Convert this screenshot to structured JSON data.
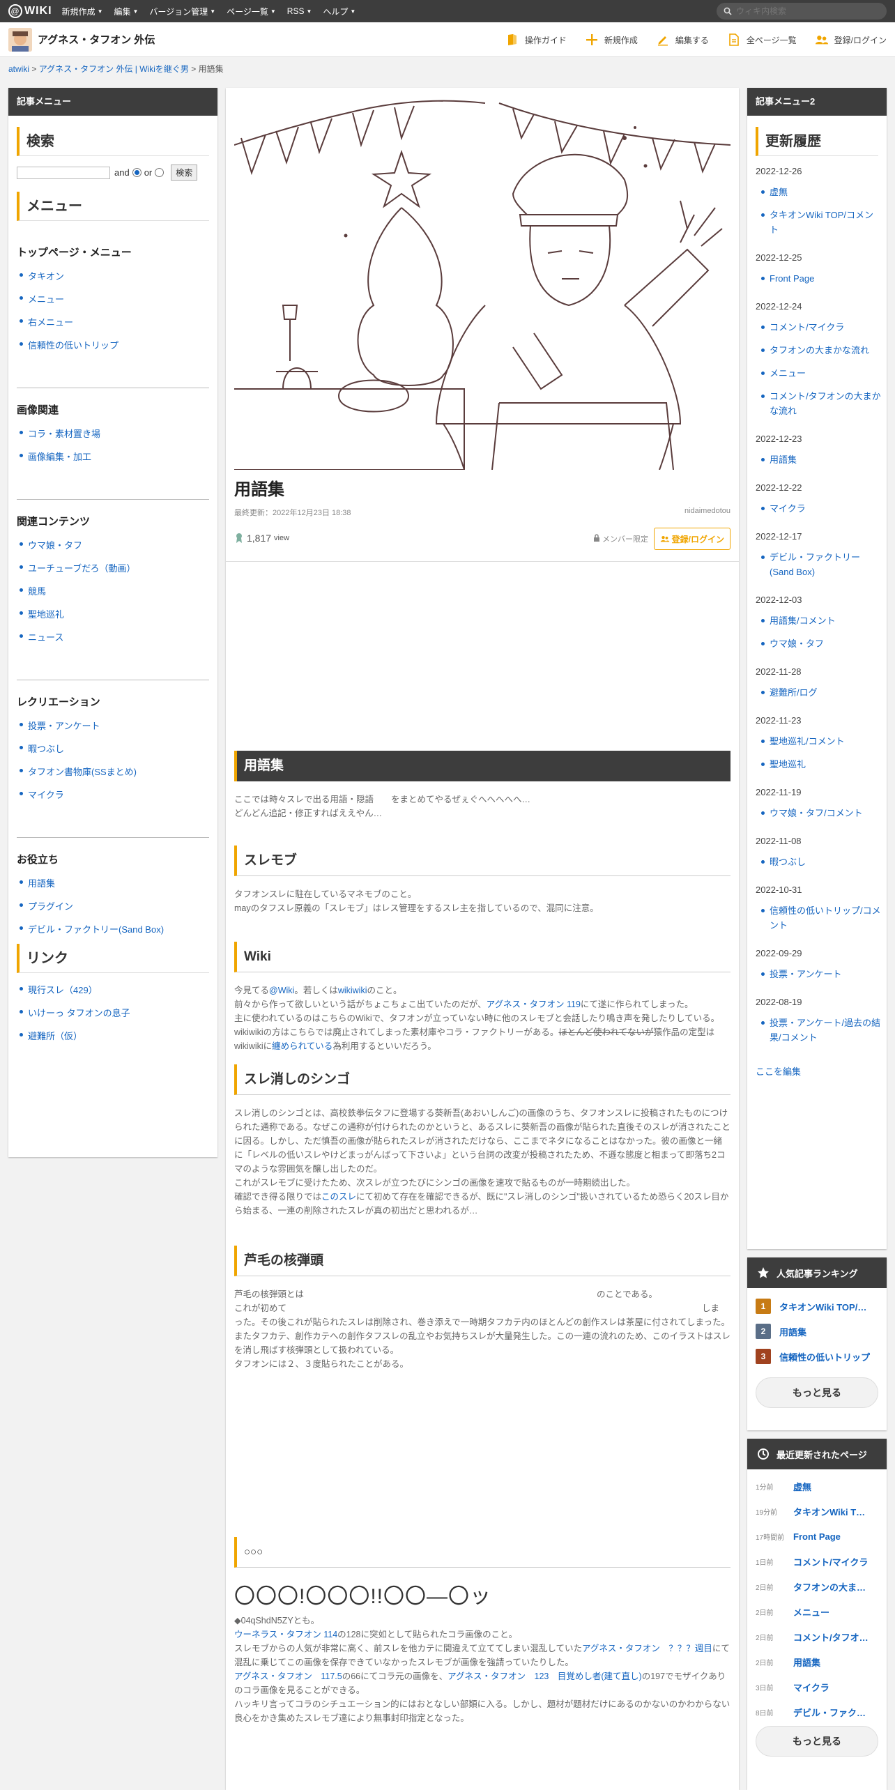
{
  "topbar": {
    "logo": "WIKI",
    "menus": [
      "新規作成",
      "編集",
      "バージョン管理",
      "ページ一覧",
      "RSS",
      "ヘルプ"
    ],
    "search_placeholder": "ウィキ内検索"
  },
  "header": {
    "site_title": "アグネス・タフオン 外伝",
    "actions": [
      "操作ガイド",
      "新規作成",
      "編集する",
      "全ページ一覧",
      "登録/ログイン"
    ]
  },
  "breadcrumb": [
    "atwiki",
    "アグネス・タフオン 外伝 | Wikiを継ぐ男",
    "用語集"
  ],
  "left_menu": {
    "panel_title": "記事メニュー",
    "search_title": "検索",
    "search_and": "and",
    "search_or": "or",
    "search_button": "検索",
    "menu_title": "メニュー",
    "groups": [
      {
        "heading": "トップページ・メニュー",
        "items": [
          "タキオン",
          "メニュー",
          "右メニュー",
          "信頼性の低いトリップ"
        ]
      },
      {
        "heading": "画像関連",
        "items": [
          "コラ・素材置き場",
          "画像編集・加工"
        ]
      },
      {
        "heading": "関連コンテンツ",
        "items": [
          "ウマ娘・タフ",
          "ユーチューブだろ（動画）",
          "競馬",
          "聖地巡礼",
          "ニュース"
        ]
      },
      {
        "heading": "レクリエーション",
        "items": [
          "投票・アンケート",
          "暇つぶし",
          "タフオン書物庫(SSまとめ)",
          "マイクラ"
        ]
      },
      {
        "heading": "お役立ち",
        "items": [
          "用語集",
          "プラグイン",
          "デビル・ファクトリー(Sand Box)"
        ]
      }
    ],
    "links_title": "リンク",
    "links": [
      "現行スレ（429）",
      "いけーっ タフオンの息子",
      "避難所（仮）"
    ]
  },
  "main": {
    "title": "用語集",
    "updated": "最終更新：2022年12月23日 18:38",
    "author": "nidaimedotou",
    "views": "1,817",
    "views_unit": "view",
    "member_only": "メンバー限定",
    "login": "登録/ログイン",
    "section_main": "用語集",
    "intro": [
      "ここでは時々スレで出る用語・隠語　　をまとめてやるぜぇぐへへへへへ…",
      "どんどん追記・修正すればええやん…"
    ],
    "sec_suremob": "スレモブ",
    "suremob_p": [
      "タフオンスレに駐在しているマネモブのこと。",
      "mayのタフスレ原義の「スレモブ」はレス管理をするスレ主を指しているので、混同に注意。"
    ],
    "sec_wiki": "Wiki",
    "wiki_p1a": "今見てる",
    "wiki_p1b": "@Wiki",
    "wiki_p1c": "。若しくは",
    "wiki_p1d": "wikiwiki",
    "wiki_p1e": "のこと。",
    "wiki_p2a": "前々から作って欲しいという話がちょこちょこ出ていたのだが、",
    "wiki_p2b": "アグネス・タフオン 119",
    "wiki_p2c": "にて遂に作られてしまった。",
    "wiki_p3": "主に使われているのはこちらのWikiで、タフオンが立っていない時に他のスレモブと会話したり鳴き声を発したりしている。",
    "wiki_p4a": "wikiwikiの方はこちらでは廃止されてしまった素材庫やコラ・ファクトリーがある。",
    "wiki_p4b": "ほとんど使われてないが",
    "wiki_p4c": "猿作品の定型はwikiwikiに",
    "wiki_p4d": "纏められている",
    "wiki_p4e": "為利用するといいだろう。",
    "sec_shingo": "スレ消しのシンゴ",
    "shingo_p1": "スレ消しのシンゴとは、高校鉄拳伝タフに登場する葵新吾(あおいしんご)の画像のうち、タフオンスレに投稿されたものにつけられた通称である。なぜこの通称が付けられたのかというと、あるスレに葵新吾の画像が貼られた直後そのスレが消されたことに因る。しかし、ただ慎吾の画像が貼られたスレが消されただけなら、ここまでネタになることはなかった。彼の画像と一緒に「レベルの低いスレやけどまっがんばって下さいよ」という台詞の改変が投稿されたため、不遜な態度と相まって即落ち2コマのような雰囲気を醸し出したのだ。",
    "shingo_p2": "これがスレモブに受けたため、次スレが立つたびにシンゴの画像を速攻で貼るものが一時期続出した。",
    "shingo_p3a": "確認でき得る限りでは",
    "shingo_p3b": "このスレ",
    "shingo_p3c": "にて初めて存在を確認できるが、既に\"スレ消しのシンゴ\"扱いされているため恐らく20スレ目から始まる、一連の削除されたスレが真の初出だと思われるが…",
    "sec_nuke": "芦毛の核弾頭",
    "nuke_p1a": "芦毛の核弾頭とは",
    "nuke_p1b": "のことである。",
    "nuke_p2a": "これが初めて",
    "nuke_p2b": "しま",
    "nuke_p3": "った。その後これが貼られたスレは削除され、巻き添えで一時期タフカテ内のほとんどの創作スレは茶屋に付されてしまった。またタフカテ、創作カテへの創作タフスレの乱立やお気持ちスレが大量発生した。この一連の流れのため、このイラストはスレを消し飛ばす核弾頭として扱われている。",
    "nuke_p4": "タフオンには２、３度貼られたことがある。",
    "sec_ooo": "○○○",
    "ooo_big": "〇〇〇!〇〇〇!!〇〇—〇ッ",
    "ooo_p1": "◆04qShdN5ZYとも。",
    "ooo_p2a": "ウーネラス・タフオン 114",
    "ooo_p2b": "の128に突如として貼られたコラ画像のこと。",
    "ooo_p3a": "スレモブからの人気が非常に高く、前スレを他カテに間違えて立ててしまい混乱していた",
    "ooo_p3b": "アグネス・タフオン　？？？週目",
    "ooo_p3c": "にて混乱に乗じてこの画像を保存できていなかったスレモブが画像を強請っていたりした。",
    "ooo_p4a": "アグネス・タフオン　117.5",
    "ooo_p4b": "の66にてコラ元の画像を、",
    "ooo_p4c": "アグネス・タフオン　123　目覚めし者(建て直し)",
    "ooo_p4d": "の197でモザイクありのコラ画像を見ることができる。",
    "ooo_p5": "ハッキリ言ってコラのシチュエーション的にはおとなしい部類に入る。しかし、題材が題材だけにあるのかないのかわからない良心をかき集めたスレモブ達により無事封印指定となった。"
  },
  "right_menu": {
    "panel_title": "記事メニュー2",
    "history_title": "更新履歴",
    "history": [
      {
        "date": "2022-12-26",
        "items": [
          "虚無",
          "タキオンWiki TOP/コメント"
        ]
      },
      {
        "date": "2022-12-25",
        "items": [
          "Front Page"
        ]
      },
      {
        "date": "2022-12-24",
        "items": [
          "コメント/マイクラ",
          "タフオンの大まかな流れ",
          "メニュー",
          "コメント/タフオンの大まかな流れ"
        ]
      },
      {
        "date": "2022-12-23",
        "items": [
          "用語集"
        ]
      },
      {
        "date": "2022-12-22",
        "items": [
          "マイクラ"
        ]
      },
      {
        "date": "2022-12-17",
        "items": [
          "デビル・ファクトリー(Sand Box)"
        ]
      },
      {
        "date": "2022-12-03",
        "items": [
          "用語集/コメント",
          "ウマ娘・タフ"
        ]
      },
      {
        "date": "2022-11-28",
        "items": [
          "避難所/ログ"
        ]
      },
      {
        "date": "2022-11-23",
        "items": [
          "聖地巡礼/コメント",
          "聖地巡礼"
        ]
      },
      {
        "date": "2022-11-19",
        "items": [
          "ウマ娘・タフ/コメント"
        ]
      },
      {
        "date": "2022-11-08",
        "items": [
          "暇つぶし"
        ]
      },
      {
        "date": "2022-10-31",
        "items": [
          "信頼性の低いトリップ/コメント"
        ]
      },
      {
        "date": "2022-09-29",
        "items": [
          "投票・アンケート"
        ]
      },
      {
        "date": "2022-08-19",
        "items": [
          "投票・アンケート/過去の結果/コメント"
        ]
      }
    ],
    "edit_link": "ここを編集"
  },
  "ranking": {
    "title": "人気記事ランキング",
    "items": [
      {
        "rank": "1",
        "title": "タキオンWiki TOP/…",
        "color": "#c77b14"
      },
      {
        "rank": "2",
        "title": "用語集",
        "color": "#5a6e87"
      },
      {
        "rank": "3",
        "title": "信頼性の低いトリップ",
        "color": "#a0421f"
      }
    ],
    "more": "もっと見る"
  },
  "recent": {
    "title": "最近更新されたページ",
    "items": [
      {
        "time": "1分前",
        "title": "虚無"
      },
      {
        "time": "19分前",
        "title": "タキオンWiki T…"
      },
      {
        "time": "17時間前",
        "title": "Front Page"
      },
      {
        "time": "1日前",
        "title": "コメント/マイクラ"
      },
      {
        "time": "2日前",
        "title": "タフオンの大ま…"
      },
      {
        "time": "2日前",
        "title": "メニュー"
      },
      {
        "time": "2日前",
        "title": "コメント/タフオ…"
      },
      {
        "time": "2日前",
        "title": "用語集"
      },
      {
        "time": "3日前",
        "title": "マイクラ"
      },
      {
        "time": "8日前",
        "title": "デビル・ファク…"
      }
    ],
    "more": "もっと見る"
  }
}
